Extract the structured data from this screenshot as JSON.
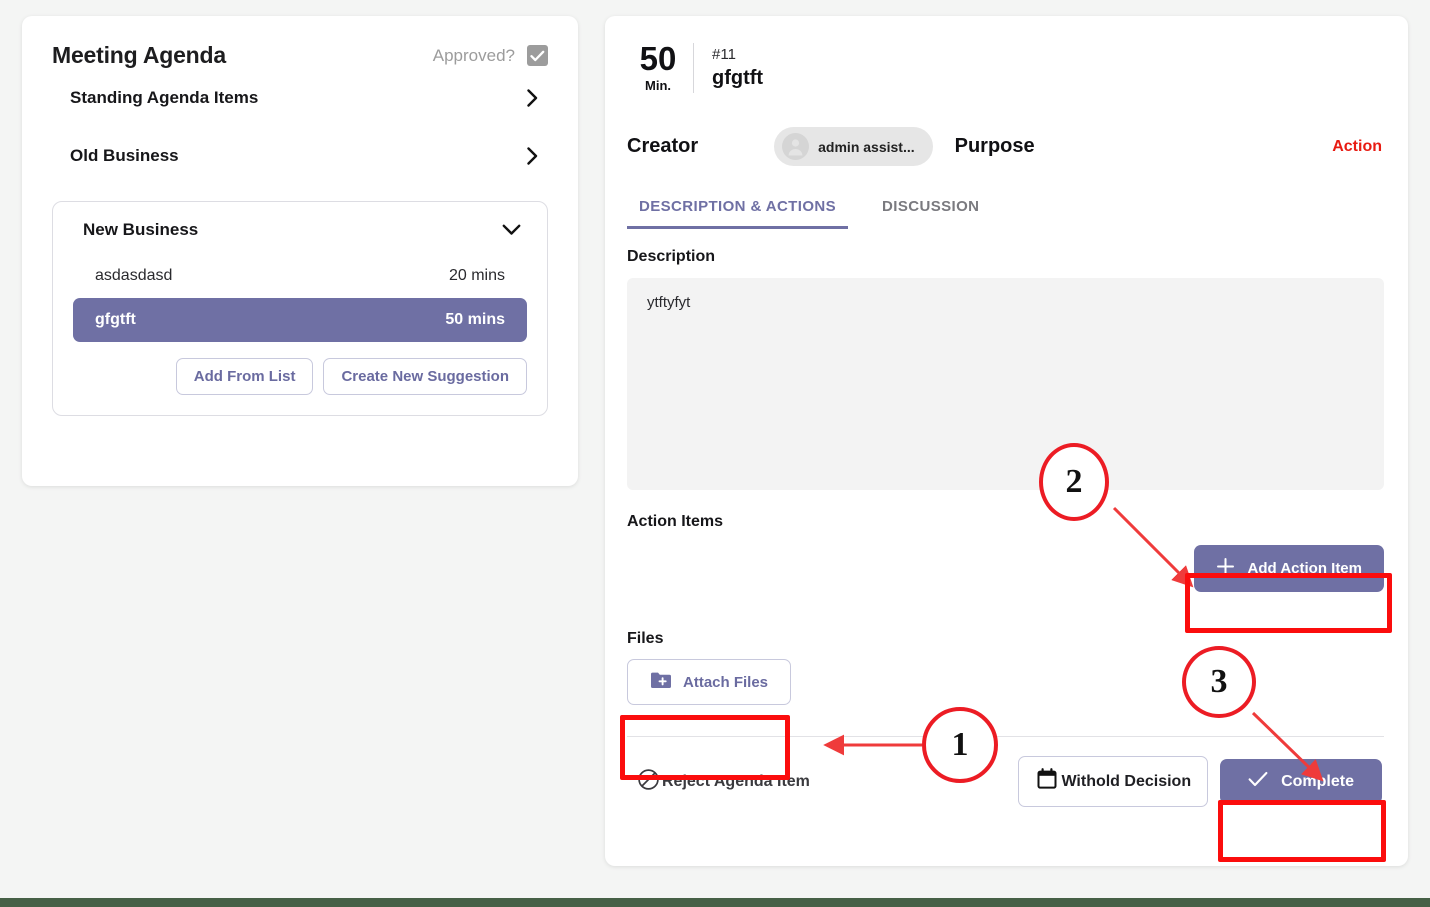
{
  "agenda": {
    "title": "Meeting Agenda",
    "approved_label": "Approved?",
    "approved_checked": true,
    "sections": [
      {
        "label": "Standing Agenda Items",
        "expanded": false
      },
      {
        "label": "Old Business",
        "expanded": false
      }
    ],
    "new_business": {
      "title": "New Business",
      "expanded": true,
      "items": [
        {
          "name": "asdasdasd",
          "duration": "20 mins",
          "selected": false
        },
        {
          "name": "gfgtft",
          "duration": "50 mins",
          "selected": true
        }
      ],
      "buttons": {
        "add_from_list": "Add From List",
        "create_new_suggestion": "Create New Suggestion"
      }
    }
  },
  "detail": {
    "minutes": "50",
    "minutes_unit": "Min.",
    "item_id": "#11",
    "item_name": "gfgtft",
    "creator_label": "Creator",
    "creator_name": "admin assist...",
    "purpose_label": "Purpose",
    "purpose_value": "Action",
    "tabs": [
      {
        "label": "DESCRIPTION & ACTIONS",
        "active": true
      },
      {
        "label": "DISCUSSION",
        "active": false
      }
    ],
    "description_label": "Description",
    "description_text": "ytftyfyt",
    "action_items_label": "Action Items",
    "add_action_item_label": "Add Action Item",
    "files_label": "Files",
    "attach_files_label": "Attach Files",
    "footer": {
      "reject_label": "Reject Agenda Item",
      "withold_label": "Withold Decision",
      "complete_label": "Complete"
    }
  },
  "annotations": {
    "markers": [
      {
        "number": "1",
        "target": "attach-files-button"
      },
      {
        "number": "2",
        "target": "add-action-item-button"
      },
      {
        "number": "3",
        "target": "complete-button"
      }
    ]
  },
  "colors": {
    "accent_purple": "#6f70a4",
    "annotation_red": "#fb0d0d",
    "purpose_red": "#e81b12",
    "page_background": "#f4f5f4",
    "bottom_strip_green": "#466046"
  }
}
